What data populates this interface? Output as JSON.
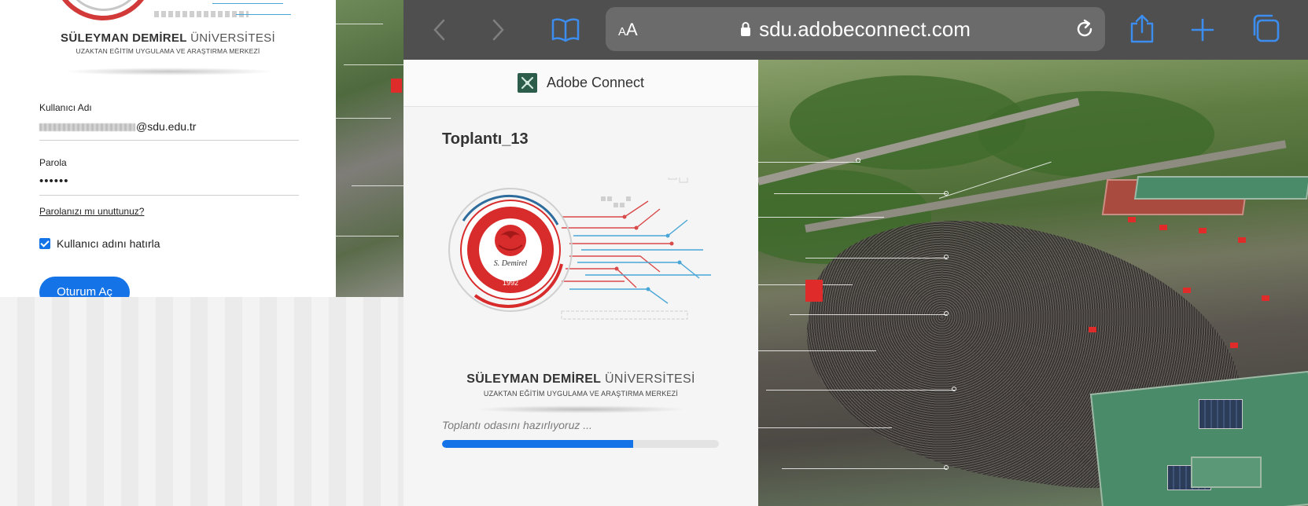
{
  "login": {
    "university_name_bold": "SÜLEYMAN DEMİREL",
    "university_name_light": "ÜNİVERSİTESİ",
    "university_subtitle": "UZAKTAN EĞİTİM UYGULAMA VE ARAŞTIRMA MERKEZİ",
    "username_label": "Kullanıcı Adı",
    "username_domain": "@sdu.edu.tr",
    "password_label": "Parola",
    "password_value": "••••••",
    "forgot_password": "Parolanızı mı unuttunuz?",
    "remember_label": "Kullanıcı adını hatırla",
    "remember_checked": true,
    "submit_label": "Oturum Aç"
  },
  "browser": {
    "aa_small": "A",
    "aa_large": "A",
    "url": "sdu.adobeconnect.com",
    "icons": [
      "back-icon",
      "forward-icon",
      "bookmarks-icon",
      "lock-icon",
      "reload-icon",
      "share-icon",
      "new-tab-icon",
      "tabs-icon"
    ]
  },
  "connect": {
    "app_title": "Adobe Connect",
    "meeting_name": "Toplantı_13",
    "university_name_bold": "SÜLEYMAN DEMİREL",
    "university_name_light": "ÜNİVERSİTESİ",
    "university_subtitle": "UZAKTAN EĞİTİM UYGULAMA VE ARAŞTIRMA MERKEZİ",
    "seal_year": "1992",
    "seal_signature": "S. Demirel",
    "status_text": "Toplantı odasını hazırlıyoruz ...",
    "progress_fraction": 0.69
  },
  "colors": {
    "accent_blue": "#1473e6",
    "toolbar_bg": "#4f4f50",
    "seal_red": "#d82b2b"
  }
}
